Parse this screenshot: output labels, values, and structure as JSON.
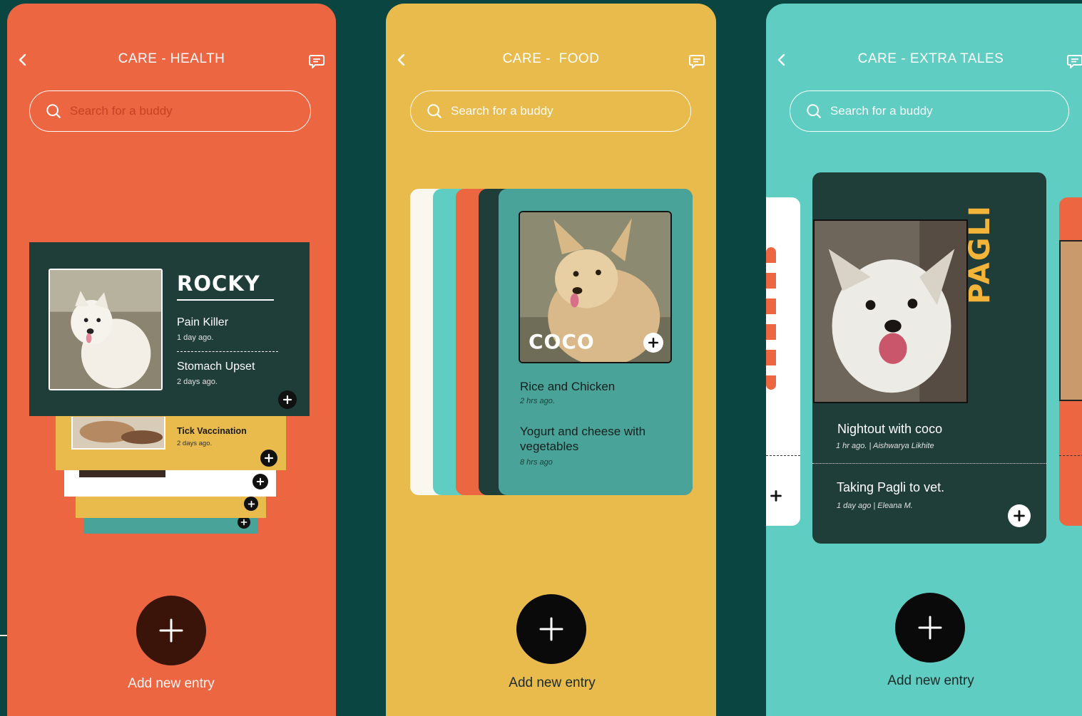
{
  "search_placeholder": "Search for a buddy",
  "add_label": "Add new entry",
  "screens": {
    "health": {
      "title": "CARE - HEALTH",
      "pet_name": "ROCKY",
      "entries": [
        {
          "title": "Pain Killer",
          "time": "1 day ago."
        },
        {
          "title": "Stomach Upset",
          "time": "2 days ago."
        }
      ],
      "stack_entry": {
        "title": "Tick Vaccination",
        "time": "2 days ago."
      }
    },
    "food": {
      "title": "CARE -  FOOD",
      "pet_name": "COCO",
      "entries": [
        {
          "title": "Rice and Chicken",
          "time": "2 hrs ago."
        },
        {
          "title": "Yogurt and cheese with vegetables",
          "time": "8 hrs ago"
        }
      ]
    },
    "tales": {
      "title": "CARE - EXTRA TALES",
      "pet_name": "PAGLI",
      "entries": [
        {
          "title": "Nightout with coco",
          "time": "1 hr ago. | Aishwarya Likhite"
        },
        {
          "title": "Taking Pagli to vet.",
          "time": "1 day ago | Eleana M."
        }
      ]
    }
  },
  "colors": {
    "orange": "#ec6642",
    "yellow": "#e9bb4d",
    "teal": "#5fcdc1",
    "dark_green": "#1f3e3a",
    "card_teal": "#4aa398",
    "background": "#0b4541"
  },
  "icons": {
    "back": "chevron-left-icon",
    "chat": "chat-bubble-icon",
    "search": "search-icon",
    "add": "plus-icon"
  }
}
